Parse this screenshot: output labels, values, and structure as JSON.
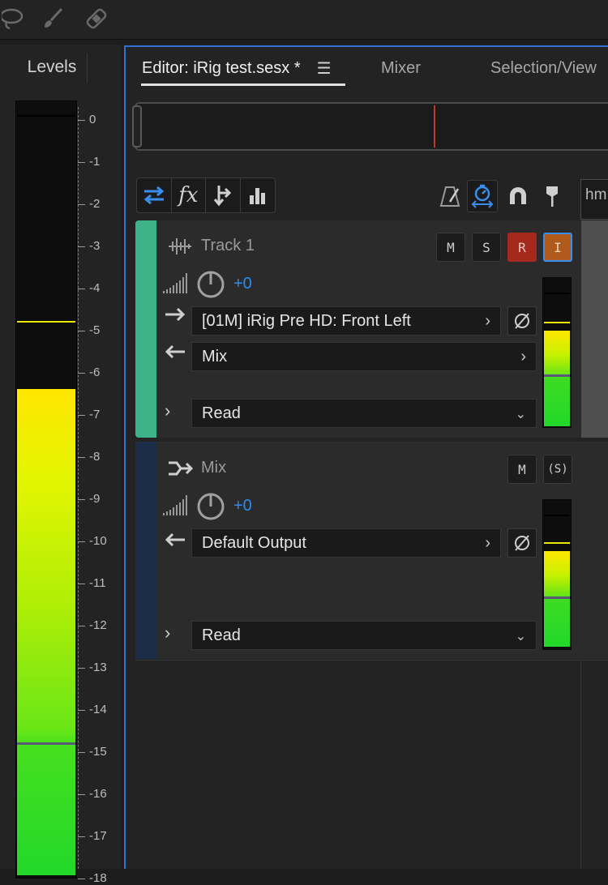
{
  "levels": {
    "tab_label": "Levels",
    "scale": [
      "0",
      "-1",
      "-2",
      "-3",
      "-4",
      "-5",
      "-6",
      "-7",
      "-8",
      "-9",
      "-10",
      "-11",
      "-12",
      "-13",
      "-14",
      "-15",
      "-16",
      "-17",
      "-18"
    ]
  },
  "editor": {
    "tabs": [
      "Editor: iRig test.sesx *",
      "Mixer",
      "Selection/View"
    ],
    "time_partial": "hm"
  },
  "tracks": [
    {
      "name": "Track 1",
      "mute": "M",
      "solo": "S",
      "record": "R",
      "input": "I",
      "volume": "+0",
      "input_route": "[01M] iRig Pre HD:  Front Left",
      "output_route": "Mix",
      "automation": "Read",
      "color": "#3db38a"
    },
    {
      "name": "Mix",
      "mute": "M",
      "solo": "(S)",
      "volume": "+0",
      "output_route": "Default Output",
      "automation": "Read",
      "color": "#1c2e47"
    }
  ],
  "colors": {
    "accent": "#2f6fd6",
    "volume_text": "#2d8ceb",
    "record_btn": "#a5291d",
    "input_btn": "#b05a1c"
  }
}
